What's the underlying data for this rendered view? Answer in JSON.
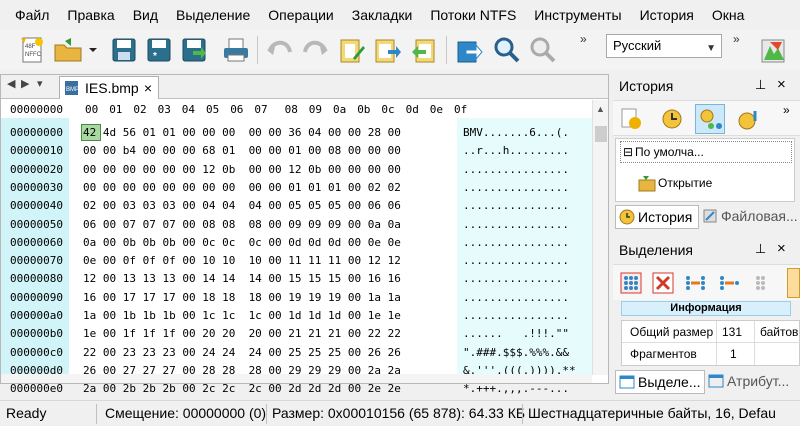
{
  "menu": [
    "Файл",
    "Правка",
    "Вид",
    "Выделение",
    "Операции",
    "Закладки",
    "Потоки NTFS",
    "Инструменты",
    "История",
    "Окна"
  ],
  "toolbar": {
    "language": "Русский",
    "buttons": [
      "new-file",
      "open-file",
      "open-dropdown",
      "save",
      "save-all",
      "save-as",
      "print",
      "undo",
      "redo",
      "edit-clipboard",
      "paste",
      "copy-to",
      "export",
      "find",
      "find-replace"
    ]
  },
  "editor": {
    "tab_label": "IES.bmp",
    "header_offset": "00000000",
    "columns": [
      "00",
      "01",
      "02",
      "03",
      "04",
      "05",
      "06",
      "07",
      "08",
      "09",
      "0a",
      "0b",
      "0c",
      "0d",
      "0e",
      "0f"
    ],
    "selected_byte": "42",
    "rows": [
      {
        "off": "00000000",
        "hex": "42 4d 56 01 01 00 00 00  00 00 36 04 00 00 28 00",
        "asc": "BMV.......6...(."
      },
      {
        "off": "00000010",
        "hex": "00 00 b4 00 00 00 68 01  00 00 01 00 08 00 00 00",
        "asc": "..r...h........."
      },
      {
        "off": "00000020",
        "hex": "00 00 00 00 00 00 12 0b  00 00 12 0b 00 00 00 00",
        "asc": "................"
      },
      {
        "off": "00000030",
        "hex": "00 00 00 00 00 00 00 00  00 00 01 01 01 00 02 02",
        "asc": "................"
      },
      {
        "off": "00000040",
        "hex": "02 00 03 03 03 00 04 04  04 00 05 05 05 00 06 06",
        "asc": "................"
      },
      {
        "off": "00000050",
        "hex": "06 00 07 07 07 00 08 08  08 00 09 09 09 00 0a 0a",
        "asc": "................"
      },
      {
        "off": "00000060",
        "hex": "0a 00 0b 0b 0b 00 0c 0c  0c 00 0d 0d 0d 00 0e 0e",
        "asc": "................"
      },
      {
        "off": "00000070",
        "hex": "0e 00 0f 0f 0f 00 10 10  10 00 11 11 11 00 12 12",
        "asc": "................"
      },
      {
        "off": "00000080",
        "hex": "12 00 13 13 13 00 14 14  14 00 15 15 15 00 16 16",
        "asc": "................"
      },
      {
        "off": "00000090",
        "hex": "16 00 17 17 17 00 18 18  18 00 19 19 19 00 1a 1a",
        "asc": "................"
      },
      {
        "off": "000000a0",
        "hex": "1a 00 1b 1b 1b 00 1c 1c  1c 00 1d 1d 1d 00 1e 1e",
        "asc": "................"
      },
      {
        "off": "000000b0",
        "hex": "1e 00 1f 1f 1f 00 20 20  20 00 21 21 21 00 22 22",
        "asc": "......   .!!!.\"\""
      },
      {
        "off": "000000c0",
        "hex": "22 00 23 23 23 00 24 24  24 00 25 25 25 00 26 26",
        "asc": "\".###.$$$.%%%.&&"
      },
      {
        "off": "000000d0",
        "hex": "26 00 27 27 27 00 28 28  28 00 29 29 29 00 2a 2a",
        "asc": "&.'''.(((.)))).**"
      },
      {
        "off": "000000e0",
        "hex": "2a 00 2b 2b 2b 00 2c 2c  2c 00 2d 2d 2d 00 2e 2e",
        "asc": "*.+++.,,,.---..."
      }
    ]
  },
  "history_panel": {
    "title": "История",
    "tree_root": "По умолча...",
    "tree_child": "Открытие",
    "tabs": [
      "История",
      "Файловая..."
    ]
  },
  "selection_panel": {
    "title": "Выделения",
    "info_header": "Информация",
    "rows": [
      {
        "label": "Общий размер",
        "value": "131",
        "unit": "байтов"
      },
      {
        "label": "Фрагментов",
        "value": "1",
        "unit": ""
      }
    ],
    "tabs": [
      "Выделе...",
      "Атрибут..."
    ]
  },
  "status": {
    "ready": "Ready",
    "offset": "Смещение: 00000000 (0)",
    "size": "Размер: 0x00010156 (65 878): 64.33 КБ",
    "mode": "Шестнадцатеричные байты, 16, Defau"
  }
}
